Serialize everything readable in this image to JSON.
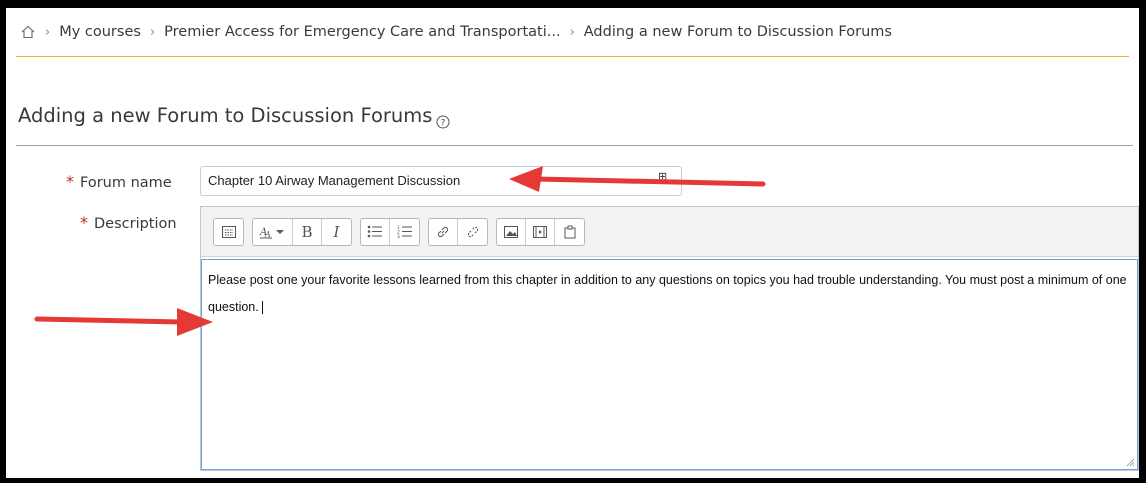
{
  "breadcrumb": {
    "home_icon": "home-icon",
    "items": [
      "My courses",
      "Premier Access for Emergency Care and Transportati...",
      "Adding a new Forum to Discussion Forums"
    ]
  },
  "page": {
    "title": "Adding a new Forum to Discussion Forums",
    "help_icon": "question-circle-icon"
  },
  "form": {
    "required_marker": "*",
    "forum_name_label": "Forum name",
    "forum_name_value": "Chapter 10 Airway Management Discussion",
    "description_label": "Description",
    "description_text": "Please post one your favorite lessons learned from this chapter in addition to any questions on topics you had trouble understanding. You must post a minimum of one question."
  },
  "toolbar": {
    "buttons": [
      "toolbar-toggle",
      "font-color",
      "bold",
      "italic",
      "unordered-list",
      "ordered-list",
      "link",
      "unlink",
      "image",
      "media",
      "manage-files"
    ],
    "bold_label": "B",
    "italic_label": "I"
  },
  "colors": {
    "accent_gold": "#e8b62c",
    "required_red": "#c62828",
    "annotation_arrow": "#e53935",
    "focus_border": "#70a5d9"
  }
}
